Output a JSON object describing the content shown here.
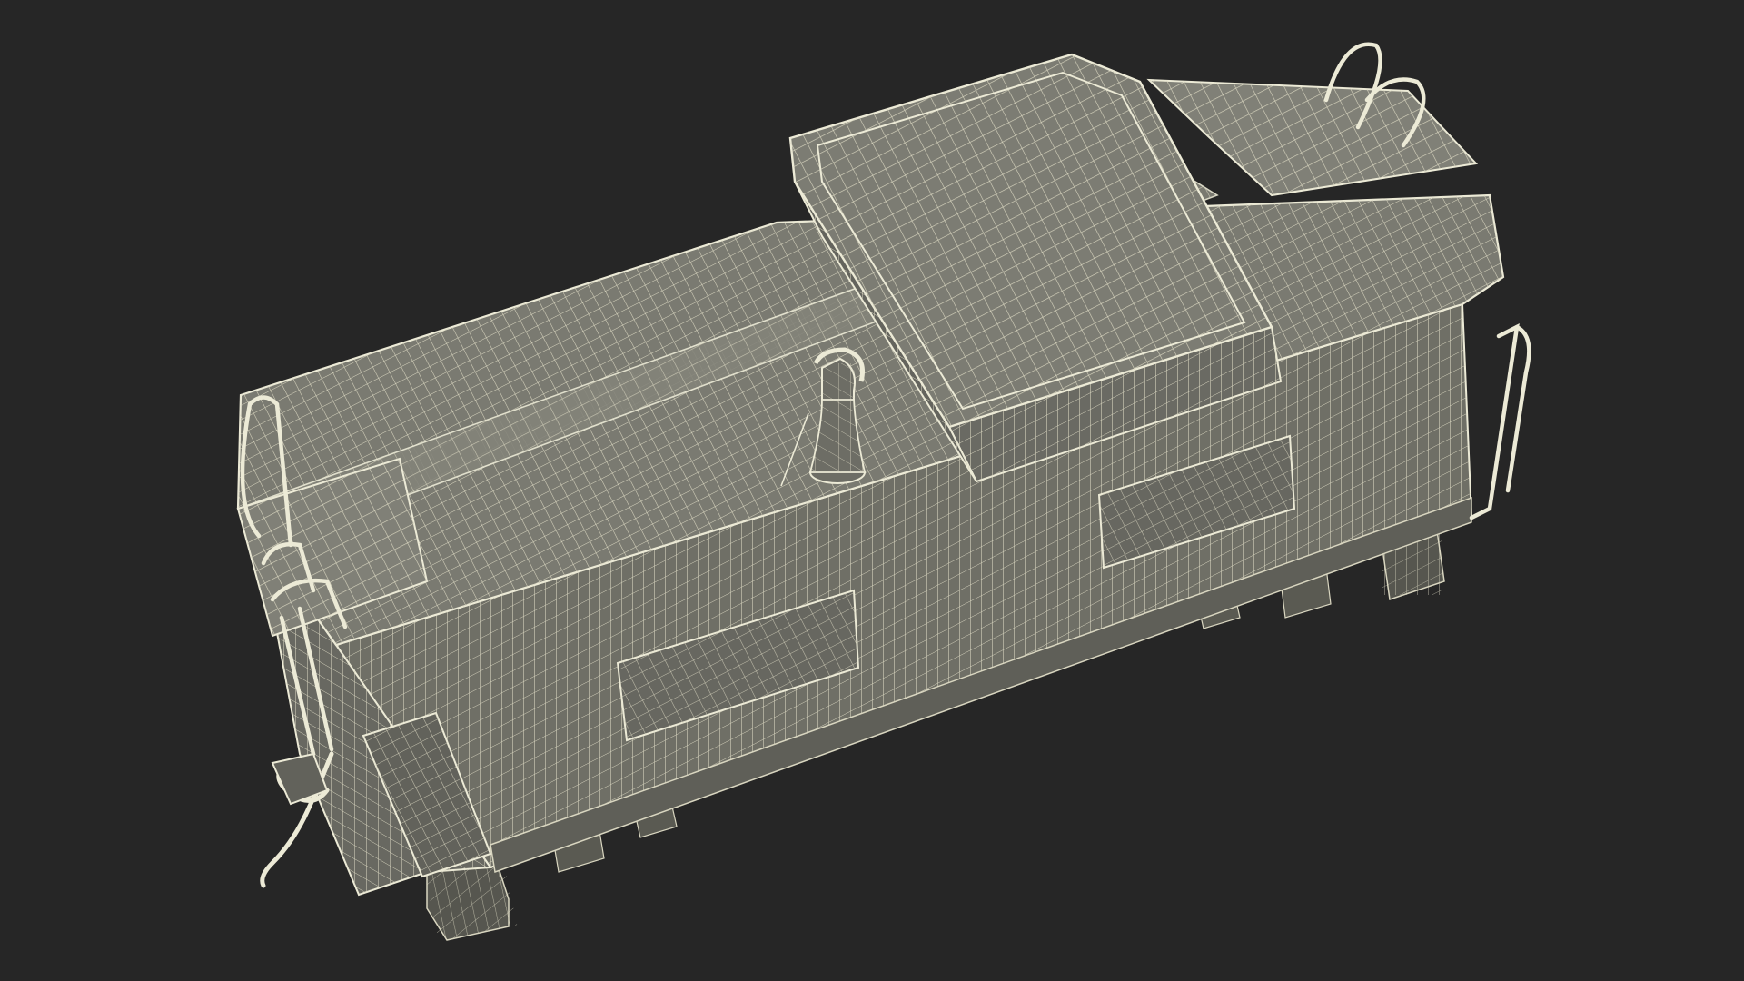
{
  "scene": {
    "subject": "caboose-wireframe-model",
    "view": "top-three-quarter",
    "colors": {
      "background": "#262626",
      "surface": "#6f6f66",
      "surface_dark": "#5a5a52",
      "surface_light": "#7d7d74",
      "wire": "#d9d6c0",
      "wire_strong": "#ecead6"
    }
  }
}
